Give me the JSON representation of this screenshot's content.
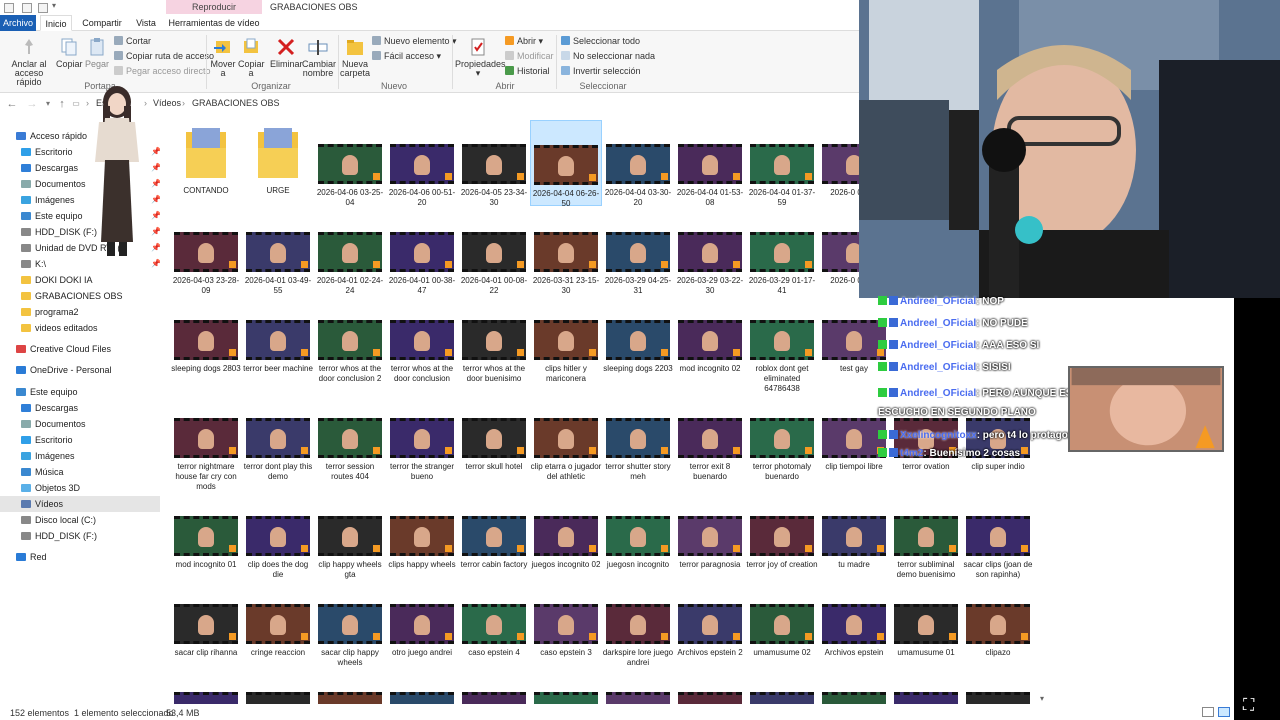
{
  "window": {
    "context_tab": "Reproducir",
    "title": "GRABACIONES OBS"
  },
  "tabs": {
    "file": "Archivo",
    "home": "Inicio",
    "share": "Compartir",
    "view": "Vista",
    "video_tools": "Herramientas de vídeo"
  },
  "ribbon": {
    "pin_quick": "Anclar al acceso rápido",
    "copy": "Copiar",
    "paste": "Pegar",
    "cut": "Cortar",
    "copy_path": "Copiar ruta de acceso",
    "paste_shortcut": "Pegar acceso directo",
    "move_to": "Mover a",
    "copy_to": "Copiar a",
    "delete": "Eliminar",
    "rename": "Cambiar nombre",
    "new_folder": "Nueva carpeta",
    "new_item": "Nuevo elemento",
    "easy_access": "Fácil acceso",
    "properties": "Propiedades",
    "open": "Abrir",
    "modify": "Modificar",
    "history": "Historial",
    "select_all": "Seleccionar todo",
    "select_none": "No seleccionar nada",
    "invert_selection": "Invertir selección",
    "group_clipboard": "Portapa",
    "group_organize": "Organizar",
    "group_new": "Nuevo",
    "group_open": "Abrir",
    "group_select": "Seleccionar"
  },
  "address": {
    "crumb1": "Este",
    "crumb2": "Vídeos",
    "crumb3": "GRABACIONES OBS"
  },
  "nav": [
    "Acceso rápido",
    "Escritorio",
    "Descargas",
    "Documentos",
    "Imágenes",
    "Este equipo",
    "HDD_DISK (F:)",
    "Unidad de DVD RW (D",
    "K:\\",
    "DOKI DOKI IA",
    "GRABACIONES OBS",
    "programa2",
    "videos editados",
    "Creative Cloud Files",
    "OneDrive - Personal",
    "Este equipo",
    "Descargas",
    "Documentos",
    "Escritorio",
    "Imágenes",
    "Música",
    "Objetos 3D",
    "Vídeos",
    "Disco local (C:)",
    "HDD_DISK (F:)",
    "Red"
  ],
  "files": [
    "CONTANDO",
    "URGE",
    "2026-04-06 03-25-04",
    "2026-04-06 00-51-20",
    "2026-04-05 23-34-30",
    "2026-04-04 06-26-50",
    "2026-04-04 03-30-20",
    "2026-04-04 01-53-08",
    "2026-04-04 01-37-59",
    "2026-0 00-51",
    "2026-04-03 23-28-09",
    "2026-04-01 03-49-55",
    "2026-04-01 02-24-24",
    "2026-04-01 00-38-47",
    "2026-04-01 00-08-22",
    "2026-03-31 23-15-30",
    "2026-03-29 04-25-31",
    "2026-03-29 03-22-30",
    "2026-03-29 01-17-41",
    "2026-0 00-19",
    "sleeping dogs 2803",
    "terror beer machine",
    "terror whos at the door conclusion 2",
    "terror whos at the door conclusion",
    "terror whos at the door buenisimo",
    "clips hitler y mariconera",
    "sleeping dogs 2203",
    "mod incognito 02",
    "roblox dont get eliminated 64786438",
    "test gay",
    "terror nightmare house far cry con mods",
    "terror dont play this demo",
    "terror session routes 404",
    "terror the stranger bueno",
    "terror skull hotel",
    "clip etarra o jugador del athletic",
    "terror shutter story meh",
    "terror exit 8 buenardo",
    "terror photomaly buenardo",
    "clip tiempoi libre",
    "terror ovation",
    "clip super indio",
    "mod incognito 01",
    "clip does the dog die",
    "clip happy wheels gta",
    "clips happy wheels",
    "terror cabin factory",
    "juegos incognito 02",
    "juegosn incognito",
    "terror paragnosia",
    "terror joy of creation",
    "tu madre",
    "terror subliminal demo buenisimo",
    "sacar clips (joan de son rapinha)",
    "sacar clip rihanna",
    "cringe reaccion",
    "sacar clip happy wheels",
    "otro juego andrei",
    "caso epstein 4",
    "caso epstein 3",
    "darkspire lore juego andrei",
    "Archivos epstein 2",
    "umamusume 02",
    "Archivos epstein",
    "umamusume 01",
    "clipazo"
  ],
  "status": {
    "count": "152 elementos",
    "selected": "1 elemento seleccionado",
    "size": "53,4 MB"
  },
  "chat": [
    {
      "user": "Andreel_OFicial",
      "msg": ": NOP"
    },
    {
      "user": "Andreel_OFicial",
      "msg": ": NO PUDE"
    },
    {
      "user": "Andreel_OFicial",
      "msg": ": AAA ESO SI"
    },
    {
      "user": "Andreel_OFicial",
      "msg": ": SISISI"
    },
    {
      "user": "Andreel_OFicial",
      "msg": ": PERO AUNQUE ESTE CON ALGO SIEMPRE TE ESCUCHO EN SEGUNDO PLANO"
    },
    {
      "user": "Xxelincognitoxx",
      "msg": ": pero t4 lo protagonizo"
    },
    {
      "user": "t4m2",
      "msg": ": Buenísimo 2 cosas"
    }
  ],
  "colors": {
    "file_tab": "#1a5fb4",
    "context_tab": "#f6d3e1",
    "selection": "#cce8ff",
    "chat_user": "#4a6cf0",
    "folder": "#f3c340"
  }
}
